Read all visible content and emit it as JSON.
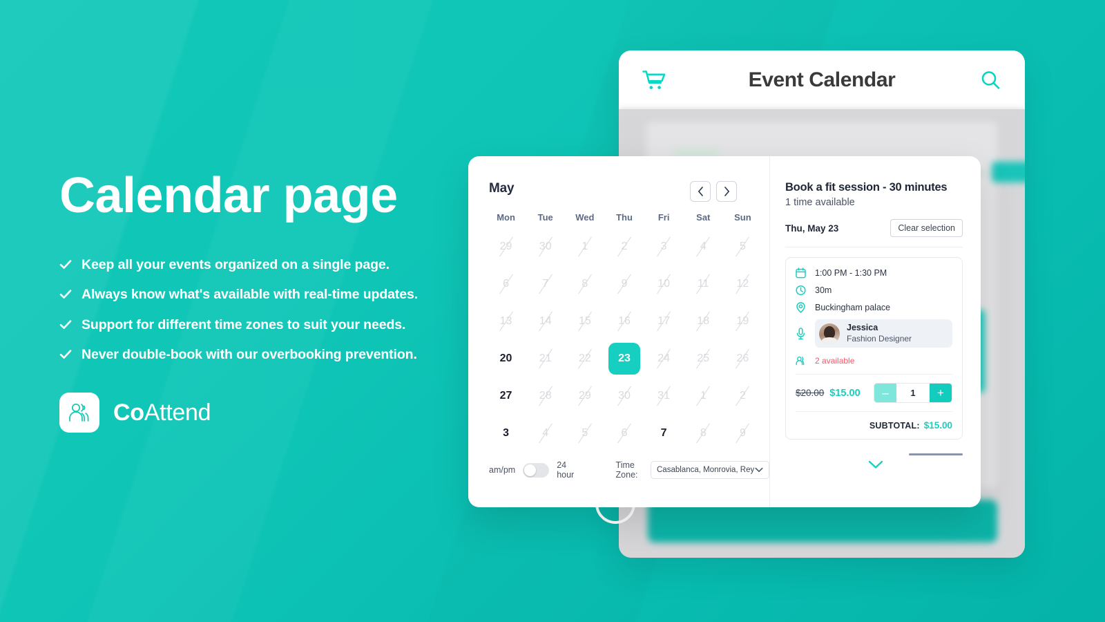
{
  "theme": {
    "brand_teal": "#0fc5b6",
    "accent_teal": "#17cfc0",
    "bright_teal": "#06d6c2",
    "dark_navy": "#1f2736",
    "alert_red": "#f1576a"
  },
  "marketing": {
    "headline": "Calendar page",
    "bullets": [
      "Keep all your events organized on a single page.",
      "Always know what's available with real-time updates.",
      "Support for different time zones to suit your needs.",
      "Never double-book with our overbooking prevention."
    ],
    "brand": {
      "name_strong": "Co",
      "name_light": "Attend",
      "logo_icon": "people-icon"
    }
  },
  "tablet": {
    "title": "Event Calendar",
    "cart_icon": "shopping-cart-icon",
    "search_icon": "search-icon"
  },
  "calendar": {
    "month": "May",
    "prev_label": "‹",
    "next_label": "›",
    "weekdays": [
      "Mon",
      "Tue",
      "Wed",
      "Thu",
      "Fri",
      "Sat",
      "Sun"
    ],
    "days": [
      {
        "label": "29",
        "state": "disabled"
      },
      {
        "label": "30",
        "state": "disabled"
      },
      {
        "label": "1",
        "state": "disabled"
      },
      {
        "label": "2",
        "state": "disabled"
      },
      {
        "label": "3",
        "state": "disabled"
      },
      {
        "label": "4",
        "state": "disabled"
      },
      {
        "label": "5",
        "state": "disabled"
      },
      {
        "label": "6",
        "state": "disabled"
      },
      {
        "label": "7",
        "state": "disabled"
      },
      {
        "label": "8",
        "state": "disabled"
      },
      {
        "label": "9",
        "state": "disabled"
      },
      {
        "label": "10",
        "state": "disabled"
      },
      {
        "label": "11",
        "state": "disabled"
      },
      {
        "label": "12",
        "state": "disabled"
      },
      {
        "label": "13",
        "state": "disabled"
      },
      {
        "label": "14",
        "state": "disabled"
      },
      {
        "label": "15",
        "state": "disabled"
      },
      {
        "label": "16",
        "state": "disabled"
      },
      {
        "label": "17",
        "state": "disabled"
      },
      {
        "label": "18",
        "state": "disabled"
      },
      {
        "label": "19",
        "state": "disabled"
      },
      {
        "label": "20",
        "state": "available"
      },
      {
        "label": "21",
        "state": "disabled"
      },
      {
        "label": "22",
        "state": "disabled"
      },
      {
        "label": "23",
        "state": "selected"
      },
      {
        "label": "24",
        "state": "disabled"
      },
      {
        "label": "25",
        "state": "disabled"
      },
      {
        "label": "26",
        "state": "disabled"
      },
      {
        "label": "27",
        "state": "available"
      },
      {
        "label": "28",
        "state": "disabled"
      },
      {
        "label": "29",
        "state": "disabled"
      },
      {
        "label": "30",
        "state": "disabled"
      },
      {
        "label": "31",
        "state": "disabled"
      },
      {
        "label": "1",
        "state": "disabled"
      },
      {
        "label": "2",
        "state": "disabled"
      },
      {
        "label": "3",
        "state": "available"
      },
      {
        "label": "4",
        "state": "disabled"
      },
      {
        "label": "5",
        "state": "disabled"
      },
      {
        "label": "6",
        "state": "disabled"
      },
      {
        "label": "7",
        "state": "available"
      },
      {
        "label": "8",
        "state": "disabled"
      },
      {
        "label": "9",
        "state": "disabled"
      }
    ],
    "footer": {
      "ampm_label": "am/pm",
      "hour24_label": "24 hour",
      "toggle_state": "off",
      "timezone_label": "Time Zone:",
      "timezone_value": "Casablanca, Monrovia, Reyk..."
    }
  },
  "booking": {
    "title": "Book a fit session - 30 minutes",
    "subtitle": "1 time available",
    "selected_date": "Thu, May 23",
    "clear_label": "Clear selection",
    "slot": {
      "time_range": "1:00 PM - 1:30 PM",
      "duration": "30m",
      "location": "Buckingham palace",
      "time_icon": "calendar-icon",
      "duration_icon": "clock-icon",
      "location_icon": "map-pin-icon",
      "speaker_icon": "microphone-icon",
      "availability_icon": "people-icon",
      "speaker": {
        "name": "Jessica",
        "role": "Fashion Designer"
      },
      "availability": "2 available",
      "price_original": "$20.00",
      "price_current": "$15.00",
      "quantity": "1",
      "minus_label": "–",
      "plus_label": "+",
      "subtotal_label": "SUBTOTAL:",
      "subtotal_value": "$15.00"
    },
    "expand_icon": "chevron-down-icon"
  }
}
